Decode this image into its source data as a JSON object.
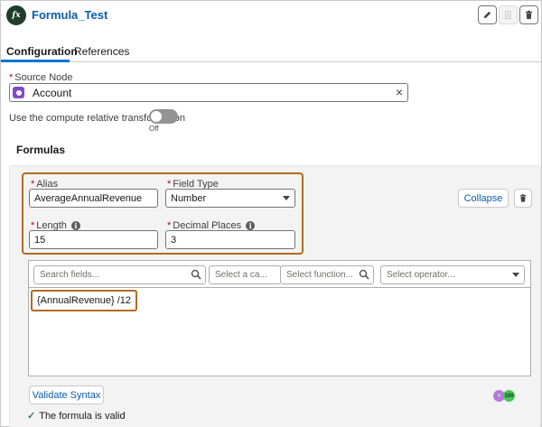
{
  "header": {
    "logo_text": "fx",
    "title": "Formula_Test",
    "icons": [
      "pencil-icon",
      "copy-icon",
      "trash-icon"
    ]
  },
  "tabs": [
    {
      "label": "Configuration",
      "active": true
    },
    {
      "label": "References",
      "active": false
    }
  ],
  "source_node": {
    "label": "Source Node",
    "required_mark": "*",
    "value": "Account",
    "icon": "object-icon",
    "clear_icon": "×"
  },
  "toggle": {
    "label": "Use the compute relative transformation",
    "state": "Off",
    "on": false
  },
  "formulas": {
    "title": "Formulas",
    "alias_label": "Alias",
    "alias_value": "AverageAnnualRevenue",
    "field_type_label": "Field Type",
    "field_type_value": "Number",
    "length_label": "Length",
    "length_value": "15",
    "decimal_label": "Decimal Places",
    "decimal_value": "3",
    "info_glyph": "i",
    "collapse_label": "Collapse",
    "search_fields_placeholder": "Search fields...",
    "category_placeholder": "Select a ca...",
    "function_placeholder": "Select function...",
    "operator_placeholder": "Select operator...",
    "formula_text": "{AnnualRevenue} /12",
    "validate_label": "Validate Syntax",
    "valid_message": "The formula is valid",
    "check_glyph": "✓",
    "badge_1": "+",
    "badge_2": "100"
  },
  "colors": {
    "accent": "#0176d3",
    "highlight": "#b36b1f",
    "success": "#2e844a",
    "node_icon": "#7f4bc4"
  }
}
